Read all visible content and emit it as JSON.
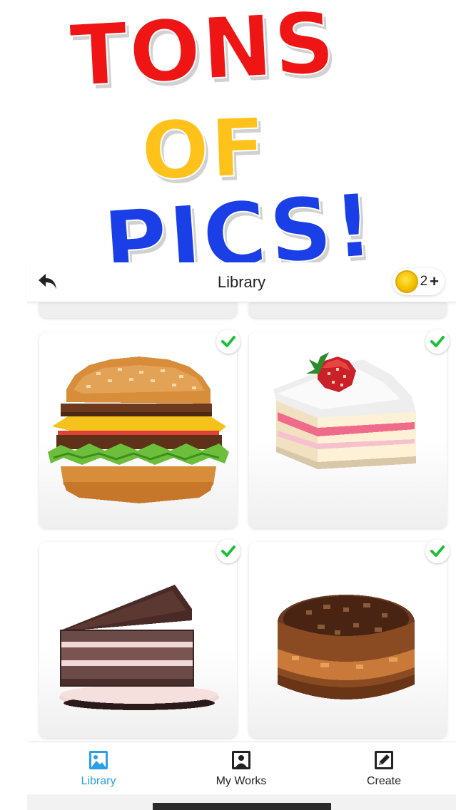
{
  "promo": {
    "line1": "TONS",
    "line2": "OF",
    "line3": "PICS!",
    "colors": {
      "line1": "#f01515",
      "line2": "#ffc21a",
      "line3": "#1a3fe6"
    }
  },
  "header": {
    "back_icon": "back-arrow-icon",
    "title": "Library",
    "coins": "2",
    "plus": "+"
  },
  "library": {
    "items": [
      {
        "name": "Burger",
        "icon": "burger-artwork",
        "completed": true
      },
      {
        "name": "Strawberry Cake Slice",
        "icon": "cake-slice-artwork",
        "completed": true
      },
      {
        "name": "Chocolate Cake Slice",
        "icon": "chocolate-cake-artwork",
        "completed": true
      },
      {
        "name": "Tiramisu Cake",
        "icon": "round-cake-artwork",
        "completed": true
      }
    ]
  },
  "nav": {
    "items": [
      {
        "label": "Library",
        "icon": "image-icon",
        "active": true
      },
      {
        "label": "My Works",
        "icon": "portrait-icon",
        "active": false
      },
      {
        "label": "Create",
        "icon": "pencil-icon",
        "active": false
      }
    ]
  },
  "colors": {
    "accent": "#2a9fe4",
    "check": "#1fbf3a"
  }
}
